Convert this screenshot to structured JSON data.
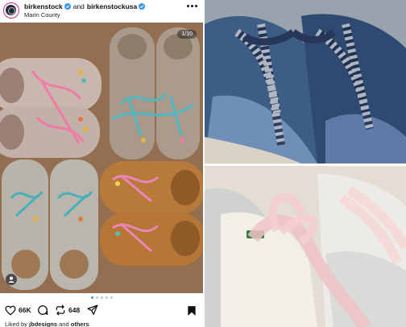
{
  "post": {
    "username_primary": "birkenstock",
    "username_connector": "and",
    "username_secondary": "birkenstockusa",
    "location": "Marin County",
    "image_counter": "1/10",
    "likes_count": "66K",
    "reposts_count": "648",
    "liked_by_prefix": "Liked by",
    "liked_by_user": "jbdesigns",
    "liked_by_suffix": "and",
    "liked_by_others": "others"
  },
  "colors": {
    "verified": "#3897f0",
    "carousel_active": "#3897f0",
    "avatar_ring": "#d62976"
  },
  "icons": [
    "more-horizontal-icon",
    "verified-badge-icon",
    "user-tag-icon",
    "heart-icon",
    "comment-icon",
    "repost-icon",
    "share-icon",
    "bookmark-icon"
  ]
}
